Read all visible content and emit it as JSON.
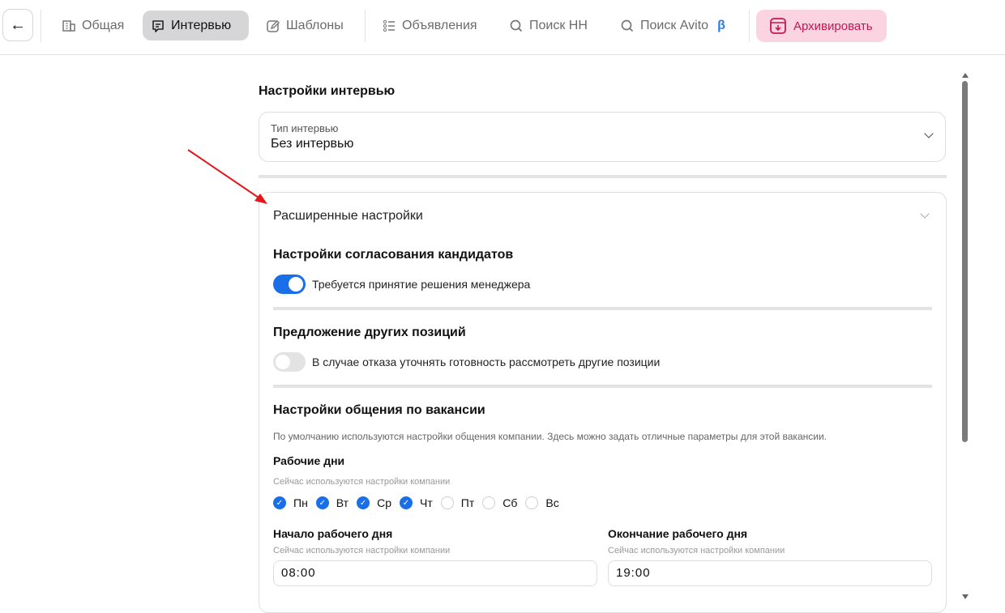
{
  "nav": {
    "tabs": [
      {
        "label": "Общая",
        "icon": "building-icon"
      },
      {
        "label": "Интервью",
        "icon": "chat-icon",
        "active": true
      },
      {
        "label": "Шаблоны",
        "icon": "edit-icon"
      },
      {
        "label": "Объявления",
        "icon": "list-icon"
      },
      {
        "label": "Поиск HH",
        "icon": "search-icon"
      },
      {
        "label": "Поиск Avito",
        "icon": "search-icon",
        "badge": "β"
      }
    ],
    "archive_label": "Архивировать"
  },
  "interview": {
    "title": "Настройки интервью",
    "type_label": "Тип интервью",
    "type_value": "Без интервью"
  },
  "advanced": {
    "title": "Расширенные настройки",
    "approval": {
      "title": "Настройки согласования кандидатов",
      "toggle_label": "Требуется принятие решения менеджера",
      "enabled": true
    },
    "offer": {
      "title": "Предложение других позиций",
      "toggle_label": "В случае отказа уточнять готовность рассмотреть другие позиции",
      "enabled": false
    },
    "comm": {
      "title": "Настройки общения по вакансии",
      "description": "По умолчанию используются настройки общения компании. Здесь можно задать отличные параметры для этой вакансии.",
      "workdays_title": "Рабочие дни",
      "hint": "Сейчас используются настройки компании",
      "days": [
        {
          "label": "Пн",
          "checked": true
        },
        {
          "label": "Вт",
          "checked": true
        },
        {
          "label": "Ср",
          "checked": true
        },
        {
          "label": "Чт",
          "checked": true
        },
        {
          "label": "Пт",
          "checked": false
        },
        {
          "label": "Сб",
          "checked": false
        },
        {
          "label": "Вс",
          "checked": false
        }
      ],
      "start_title": "Начало рабочего дня",
      "start_value": "08:00",
      "end_title": "Окончание рабочего дня",
      "end_value": "19:00"
    }
  },
  "colors": {
    "accent": "#1a6ee8",
    "archive_bg": "#fcd3e1",
    "archive_text": "#c2184f",
    "annotation": "#e8141c"
  }
}
